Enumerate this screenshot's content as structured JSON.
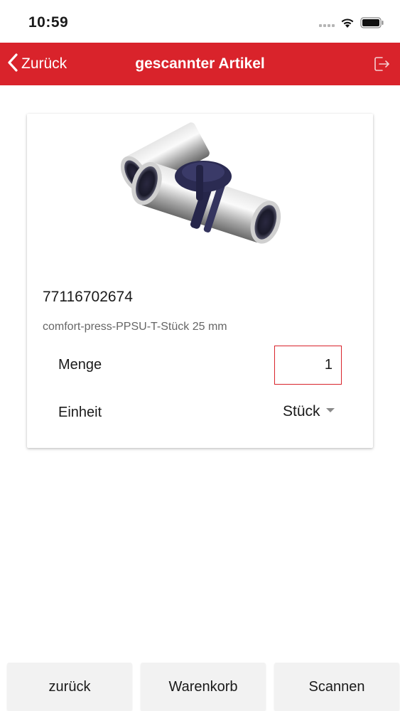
{
  "status_bar": {
    "time": "10:59"
  },
  "nav": {
    "back_label": "Zurück",
    "title": "gescannter Artikel",
    "accent_color": "#d9232b"
  },
  "icons": {
    "back": "chevron-left-icon",
    "logout": "logout-icon",
    "dropdown": "caret-down-icon",
    "wifi": "wifi-icon",
    "battery": "battery-icon",
    "signal": "signal-icon"
  },
  "article": {
    "number": "77116702674",
    "description": "comfort-press-PPSU-T-Stück 25 mm",
    "image": "press-fitting-tee-image"
  },
  "form": {
    "quantity_label": "Menge",
    "quantity_value": "1",
    "unit_label": "Einheit",
    "unit_value": "Stück"
  },
  "bottom": {
    "back_label": "zurück",
    "cart_label": "Warenkorb",
    "scan_label": "Scannen"
  }
}
